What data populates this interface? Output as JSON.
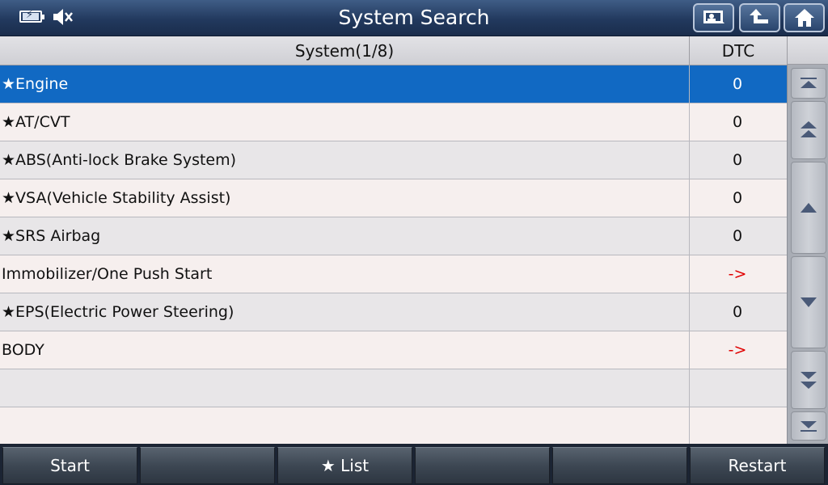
{
  "header": {
    "title": "System Search",
    "status_icons": [
      "battery-charging-icon",
      "speaker-muted-icon"
    ],
    "buttons": [
      "print-screen-icon",
      "back-up-icon",
      "home-icon"
    ]
  },
  "table": {
    "columns": {
      "system": "System(1/8)",
      "dtc": "DTC"
    },
    "rows": [
      {
        "name": "★Engine",
        "dtc": "0",
        "selected": true
      },
      {
        "name": "★AT/CVT",
        "dtc": "0"
      },
      {
        "name": "★ABS(Anti-lock Brake System)",
        "dtc": "0"
      },
      {
        "name": "★VSA(Vehicle Stability Assist)",
        "dtc": "0"
      },
      {
        "name": "★SRS Airbag",
        "dtc": "0"
      },
      {
        "name": "Immobilizer/One Push Start",
        "dtc": "->"
      },
      {
        "name": "★EPS(Electric Power Steering)",
        "dtc": "0"
      },
      {
        "name": "BODY",
        "dtc": "->"
      },
      {
        "name": "",
        "dtc": ""
      },
      {
        "name": "",
        "dtc": ""
      }
    ]
  },
  "scroll": [
    "scroll-top-icon",
    "page-up-icon",
    "line-up-icon",
    "line-down-icon",
    "page-down-icon",
    "scroll-bottom-icon"
  ],
  "bottom_bar": {
    "start": "Start",
    "blank1": "",
    "list": "★ List",
    "blank2": "",
    "blank3": "",
    "restart": "Restart"
  },
  "colors": {
    "title_bar": "#22395e",
    "selected_row": "#1169c3",
    "arrow_text": "#e00000",
    "bottom_bar": "#3d4753"
  }
}
